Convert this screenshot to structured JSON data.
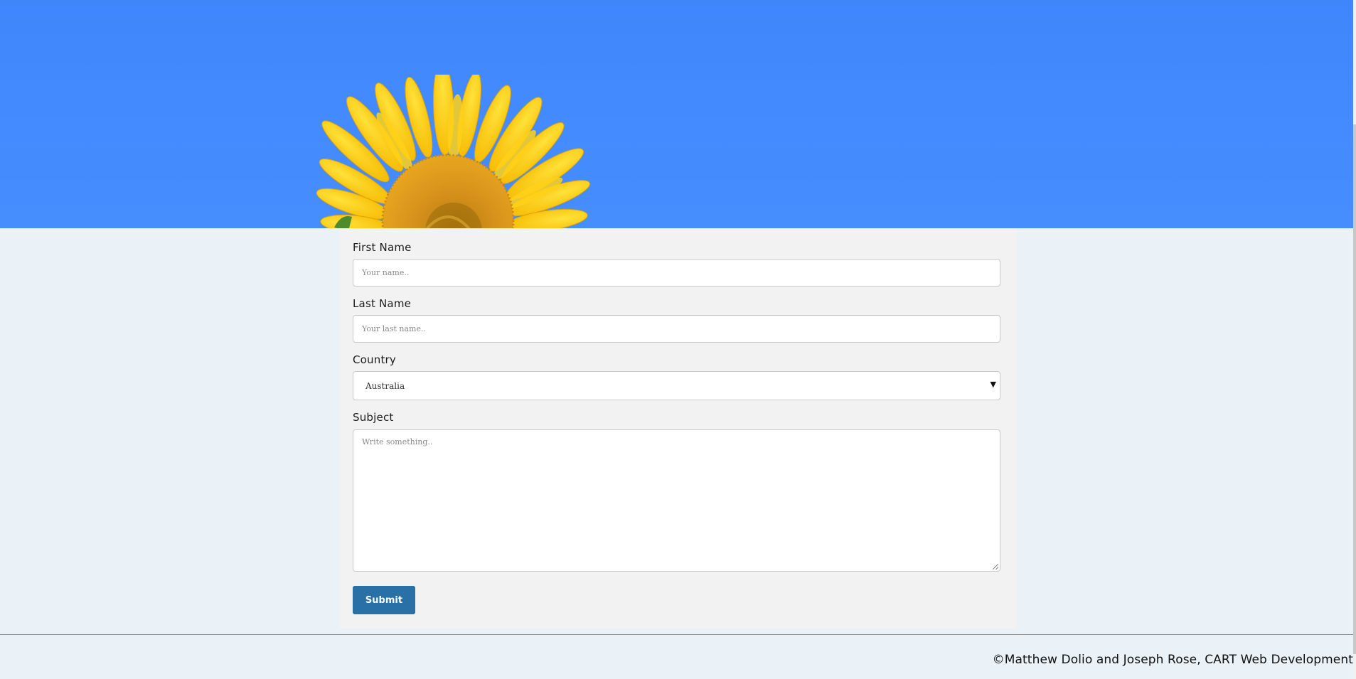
{
  "form": {
    "first_name": {
      "label": "First Name",
      "placeholder": "Your name.."
    },
    "last_name": {
      "label": "Last Name",
      "placeholder": "Your last name.."
    },
    "country": {
      "label": "Country",
      "selected": "Australia"
    },
    "subject": {
      "label": "Subject",
      "placeholder": "Write something.."
    },
    "submit_label": "Submit"
  },
  "footer": {
    "copyright": "©Matthew Dolio and Joseph Rose, CART Web Development"
  },
  "colors": {
    "hero_sky": "#4189fd",
    "page_background": "#eaf2f8",
    "form_background": "#f2f2f2",
    "submit_button": "#2870a5"
  },
  "icons": {
    "hero": "sunflower",
    "select_arrow": "triangle-down"
  }
}
